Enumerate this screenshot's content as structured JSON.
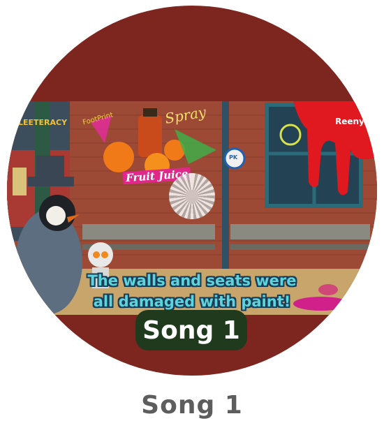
{
  "cover": {
    "subtitle_line1": "The walls and seats were",
    "subtitle_line2": "all damaged with paint!",
    "badge_text": "Song 1",
    "graffiti_fruit_juice": "Fruit Juice",
    "graffiti_spray": "Spray",
    "graffiti_footprint": "FootPrint",
    "brand_left": "LEETERACY",
    "brand_right": "Reeny",
    "sign_text": "PK",
    "play_icon": "spinner-play-icon"
  },
  "caption": {
    "title": "Song 1"
  },
  "colors": {
    "disc": "#7d2620",
    "brick": "#9a4a35",
    "subtitle_fill": "#5dd4dd",
    "subtitle_outline": "#1a3c55",
    "badge_fill": "#1f3a1c",
    "caption_text": "#5d5d5d"
  }
}
